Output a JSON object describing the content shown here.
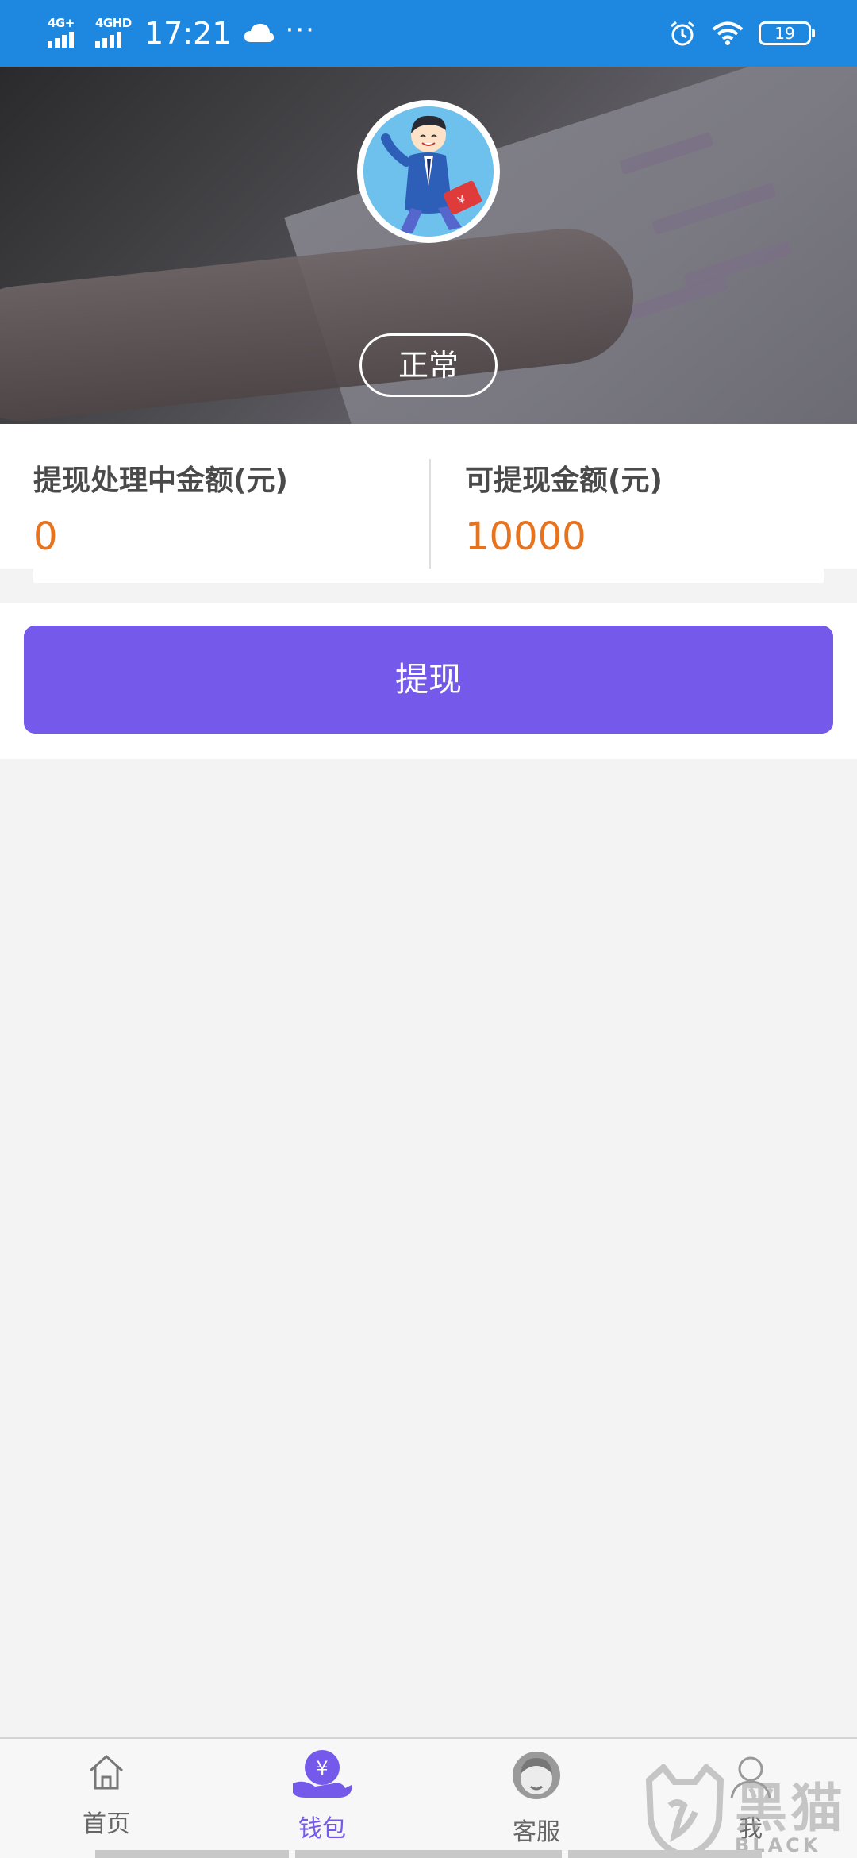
{
  "status_bar": {
    "network_1": "4G+",
    "network_2": "4GHD",
    "time": "17:21",
    "more": "···",
    "battery": "19",
    "icons": [
      "signal-icon",
      "cloud-icon",
      "alarm-icon",
      "wifi-icon",
      "battery-icon"
    ]
  },
  "profile": {
    "status": "正常"
  },
  "stats": {
    "processing_label": "提现处理中金额(元)",
    "processing_value": "0",
    "available_label": "可提现金额(元)",
    "available_value": "10000"
  },
  "actions": {
    "withdraw_label": "提现"
  },
  "tab_bar": {
    "items": [
      {
        "label": "首页",
        "icon": "home-icon"
      },
      {
        "label": "钱包",
        "icon": "wallet-icon",
        "active": true
      },
      {
        "label": "客服",
        "icon": "customer-service-icon"
      },
      {
        "label": "我",
        "icon": "profile-icon"
      }
    ]
  },
  "watermark": {
    "text": "黑猫",
    "subtext": "BLACK CAT"
  },
  "colors": {
    "status_bar": "#1e88e0",
    "accent": "#7559ea",
    "amount": "#e8731e",
    "background": "#f3f3f3"
  }
}
